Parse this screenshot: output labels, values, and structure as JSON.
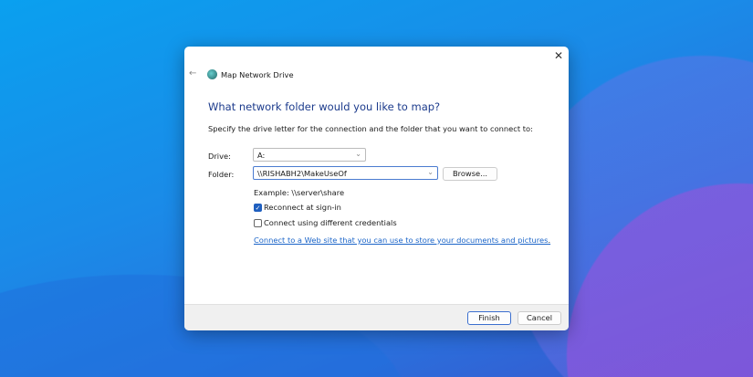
{
  "dialog": {
    "title": "Map Network Drive",
    "heading": "What network folder would you like to map?",
    "description": "Specify the drive letter for the connection and the folder that you want to connect to:",
    "drive_label": "Drive:",
    "drive_value": "A:",
    "folder_label": "Folder:",
    "folder_value": "\\\\RISHABH2\\MakeUseOf",
    "browse_label": "Browse...",
    "example": "Example: \\\\server\\share",
    "reconnect_label": "Reconnect at sign-in",
    "reconnect_checked": true,
    "credentials_label": "Connect using different credentials",
    "credentials_checked": false,
    "link": "Connect to a Web site that you can use to store your documents and pictures",
    "link_suffix": ".",
    "finish_label": "Finish",
    "cancel_label": "Cancel",
    "close_icon": "✕",
    "back_icon": "←"
  }
}
